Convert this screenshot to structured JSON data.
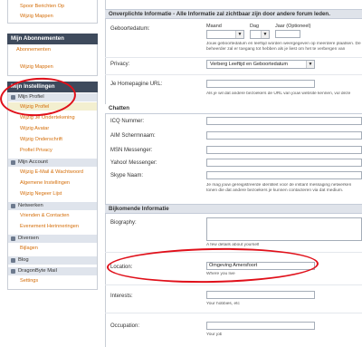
{
  "sidebar": {
    "top_links": [
      "Spoor Berichten Op",
      "Wijzig Mappen"
    ],
    "subscriptions": {
      "title": "Mijn Abonnementen",
      "links": [
        "Abonnementen",
        "Wijzig Mappen"
      ]
    },
    "settings": {
      "title": "Mijn Instellingen",
      "profile_category": "Mijn Profiel",
      "profile_links": [
        "Wijzig Profiel",
        "Wijzig Je Ondertekening",
        "Wijzig Avatar",
        "Wijzig Onderschrift",
        "Profiel Privacy"
      ],
      "account_category": "Mijn Account",
      "account_links": [
        "Wijzig E-Mail & Wachtwoord",
        "Algemene Instellingen",
        "Wijzig Negeer Lijst"
      ],
      "network_category": "Netwerken",
      "network_links": [
        "Vrienden & Contacten",
        "Evenement Herinneringen"
      ],
      "misc_category": "Diversen",
      "misc_links": [
        "Bijlagen"
      ],
      "blog_category": "Blog",
      "mail_category": "DragonByte Mail",
      "mail_links": [
        "Settings"
      ]
    }
  },
  "main": {
    "required_section": {
      "title": "Onverplichte Informatie - Alle Informatie zal zichtbaar zijn door andere forum leden.",
      "birthday_label": "Geboortedatum:",
      "birthday_columns": [
        "Maand",
        "Dag",
        "Jaar (Optioneel)"
      ],
      "birthday_help": "Jouw geboortedatum en leeftijd worden weergegeven op meerdere plaatsen. De beheerder zal er toegang tot hebben als je liest om het te verbergen van",
      "privacy_label": "Privacy:",
      "privacy_value": "Verberg Leeftijd en Geboortedatum",
      "homepage_label": "Je Homepagine URL:",
      "homepage_help": "Als je wil dat andere bezoekers de URL van jouw website kennen, vul deze"
    },
    "chat_section": {
      "title": "Chatten",
      "fields": [
        "ICQ Nummer:",
        "AIM Schermnaam:",
        "MSN Messenger:",
        "Yahoo! Messenger:",
        "Skype Naam:"
      ],
      "help": "Je mag jouw gereigistreerde identiteit voor de instant messaging netwerken tonen die dat andere bezoekers je kunnen contacteren via dat medium."
    },
    "extra_section": {
      "title": "Bijkomende Informatie",
      "biography_label": "Biography:",
      "biography_help": "A few details about yourself",
      "location_label": "Location:",
      "location_value": "Omgeving Amersfoort",
      "location_help": "Where you live",
      "interests_label": "Interests:",
      "interests_help": "Your hobbies, etc",
      "occupation_label": "Occupation:",
      "occupation_help": "Your job"
    }
  },
  "colors": {
    "link": "#d46d08",
    "sidebar_header": "#3e4a5c",
    "annotation": "#e0101a"
  }
}
